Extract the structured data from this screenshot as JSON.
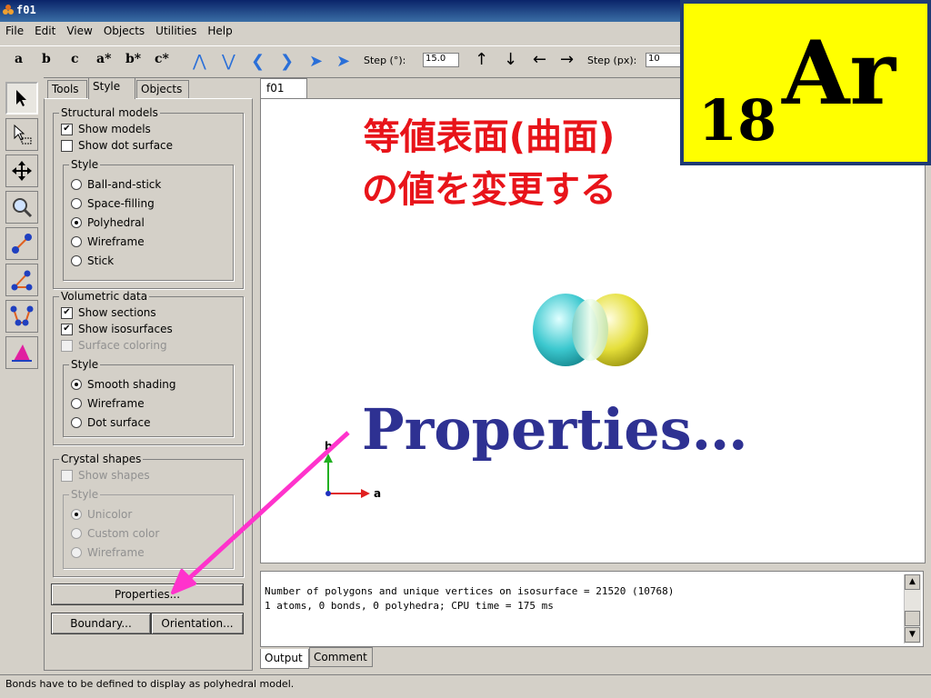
{
  "window": {
    "title": "f01"
  },
  "menu": [
    "File",
    "Edit",
    "View",
    "Objects",
    "Utilities",
    "Help"
  ],
  "toolbar": {
    "axis_buttons": [
      "a",
      "b",
      "c",
      "a*",
      "b*",
      "c*"
    ],
    "rot_step_label": "Step (°):",
    "rot_step_value": "15.0",
    "trans_step_label": "Step (px):",
    "trans_step_value": "10"
  },
  "tool_icons": [
    "select-arrow-icon",
    "select-box-icon",
    "move-icon",
    "zoom-icon",
    "bond-icon",
    "angle-icon",
    "dihedral-icon",
    "plane-icon"
  ],
  "panel": {
    "tabs": [
      "Tools",
      "Style",
      "Objects"
    ],
    "structural": {
      "title": "Structural models",
      "show_models": "Show models",
      "show_dot_surface": "Show dot surface",
      "style_title": "Style",
      "styles": [
        "Ball-and-stick",
        "Space-filling",
        "Polyhedral",
        "Wireframe",
        "Stick"
      ],
      "selected": "Polyhedral"
    },
    "volumetric": {
      "title": "Volumetric data",
      "show_sections": "Show sections",
      "show_isosurfaces": "Show isosurfaces",
      "surface_coloring": "Surface coloring",
      "style_title": "Style",
      "styles": [
        "Smooth shading",
        "Wireframe",
        "Dot surface"
      ],
      "selected": "Smooth shading"
    },
    "crystal": {
      "title": "Crystal shapes",
      "show_shapes": "Show shapes",
      "style_title": "Style",
      "styles": [
        "Unicolor",
        "Custom color",
        "Wireframe"
      ]
    },
    "buttons": {
      "properties": "Properties...",
      "boundary": "Boundary...",
      "orientation": "Orientation..."
    }
  },
  "view": {
    "tab": "f01",
    "axis_a": "a",
    "axis_b": "b"
  },
  "output": {
    "lines": [
      "Number of polygons and unique vertices on isosurface = 21520 (10768)",
      "1 atoms, 0 bonds, 0 polyhedra; CPU time = 175 ms"
    ],
    "tabs": [
      "Output",
      "Comment"
    ]
  },
  "status": "Bonds have to be defined to display as polyhedral model.",
  "overlay": {
    "japanese_line1": "等値表面(曲面)",
    "japanese_line2": "の値を変更する",
    "element_number": "18",
    "element_symbol": "Ar",
    "properties_caption": "Properties…"
  },
  "colors": {
    "red": "#e8141a",
    "navy": "#2e3192",
    "yellow": "#ffff00",
    "arrow": "#ff33cc"
  }
}
